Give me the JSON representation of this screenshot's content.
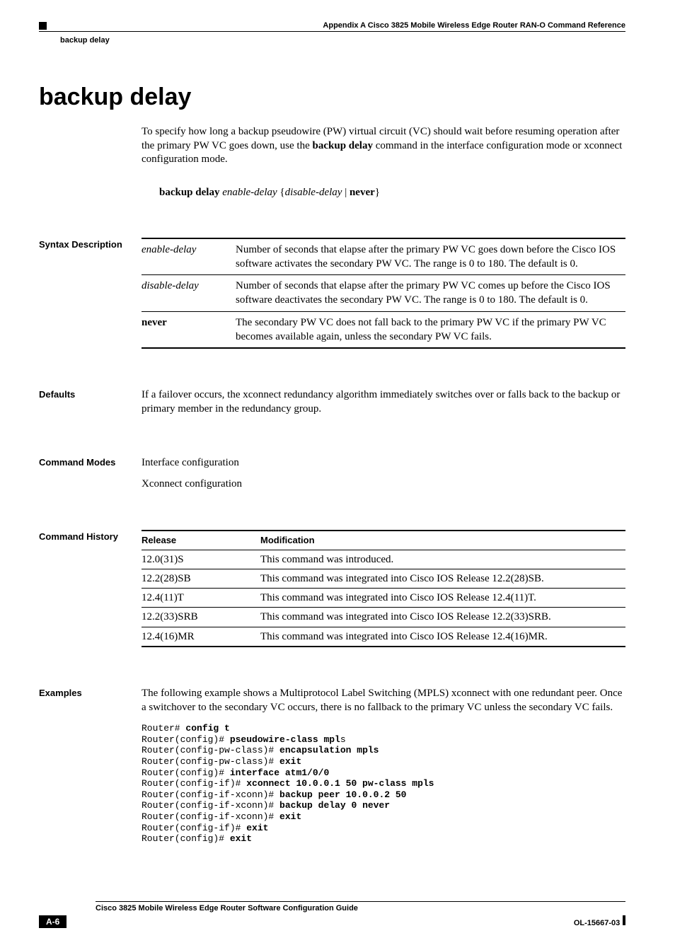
{
  "header": {
    "appendix": "Appendix A    Cisco 3825 Mobile Wireless Edge Router RAN-O Command Reference",
    "breadcrumb": "backup delay"
  },
  "title": "backup delay",
  "intro": {
    "p1a": "To specify how long a backup pseudowire (PW) virtual circuit (VC) should wait before resuming operation after the primary PW VC goes down, use the ",
    "p1b": "backup delay",
    "p1c": " command in the interface configuration mode or xconnect configuration mode."
  },
  "syntax": {
    "cmd": "backup delay",
    "arg1": "enable-delay",
    "brace_open": "{",
    "arg2": "disable-delay",
    "pipe": " | ",
    "never": "never",
    "brace_close": "}"
  },
  "sections": {
    "syntax_label": "Syntax Description",
    "defaults_label": "Defaults",
    "modes_label": "Command Modes",
    "history_label": "Command History",
    "examples_label": "Examples"
  },
  "syntax_desc": [
    {
      "param": "enable-delay",
      "italic": true,
      "desc": "Number of seconds that elapse after the primary PW VC goes down before the Cisco IOS software activates the secondary PW VC. The range is 0 to 180. The default is 0."
    },
    {
      "param": "disable-delay",
      "italic": true,
      "desc": "Number of seconds that elapse after the primary PW VC comes up before the Cisco IOS software deactivates the secondary PW VC. The range is 0 to 180. The default is 0."
    },
    {
      "param": "never",
      "italic": false,
      "desc": "The secondary PW VC does not fall back to the primary PW VC if the primary PW VC becomes available again, unless the secondary PW VC fails."
    }
  ],
  "defaults_text": "If a failover occurs, the xconnect redundancy algorithm immediately switches over or falls back to the backup or primary member in the redundancy group.",
  "modes": {
    "m1": "Interface configuration",
    "m2": "Xconnect configuration"
  },
  "history": {
    "h_release": "Release",
    "h_mod": "Modification",
    "rows": [
      {
        "rel": "12.0(31)S",
        "mod": "This command was introduced."
      },
      {
        "rel": "12.2(28)SB",
        "mod": "This command was integrated into Cisco IOS Release 12.2(28)SB."
      },
      {
        "rel": "12.4(11)T",
        "mod": "This command was integrated into Cisco IOS Release 12.4(11)T."
      },
      {
        "rel": "12.2(33)SRB",
        "mod": "This command was integrated into Cisco IOS Release 12.2(33)SRB."
      },
      {
        "rel": "12.4(16)MR",
        "mod": "This command was integrated into Cisco IOS Release 12.4(16)MR."
      }
    ]
  },
  "examples_intro": "The following example shows a Multiprotocol Label Switching (MPLS) xconnect with one redundant peer. Once a switchover to the secondary VC occurs, there is no fallback to the primary VC unless the secondary VC fails.",
  "code": [
    {
      "p": "Router# ",
      "b": "config t",
      "t": ""
    },
    {
      "p": "Router(config)# ",
      "b": "pseudowire-class mpl",
      "t": "s"
    },
    {
      "p": "Router(config-pw-class)# ",
      "b": "encapsulation mpls",
      "t": ""
    },
    {
      "p": "Router(config-pw-class)# ",
      "b": "exit",
      "t": ""
    },
    {
      "p": "Router(config)# ",
      "b": "interface atm1/0/0",
      "t": ""
    },
    {
      "p": "Router(config-if)# ",
      "b": "xconnect 10.0.0.1 50 pw-class mpls",
      "t": ""
    },
    {
      "p": "Router(config-if-xconn)# ",
      "b": "backup peer 10.0.0.2 50",
      "t": ""
    },
    {
      "p": "Router(config-if-xconn)# ",
      "b": "backup delay 0 never",
      "t": ""
    },
    {
      "p": "Router(config-if-xconn)# ",
      "b": "exit",
      "t": ""
    },
    {
      "p": "Router(config-if)# ",
      "b": "exit",
      "t": ""
    },
    {
      "p": "Router(config)# ",
      "b": "exit",
      "t": ""
    }
  ],
  "footer": {
    "guide": "Cisco 3825 Mobile Wireless Edge Router Software Configuration Guide",
    "page": "A-6",
    "docid": "OL-15667-03"
  }
}
